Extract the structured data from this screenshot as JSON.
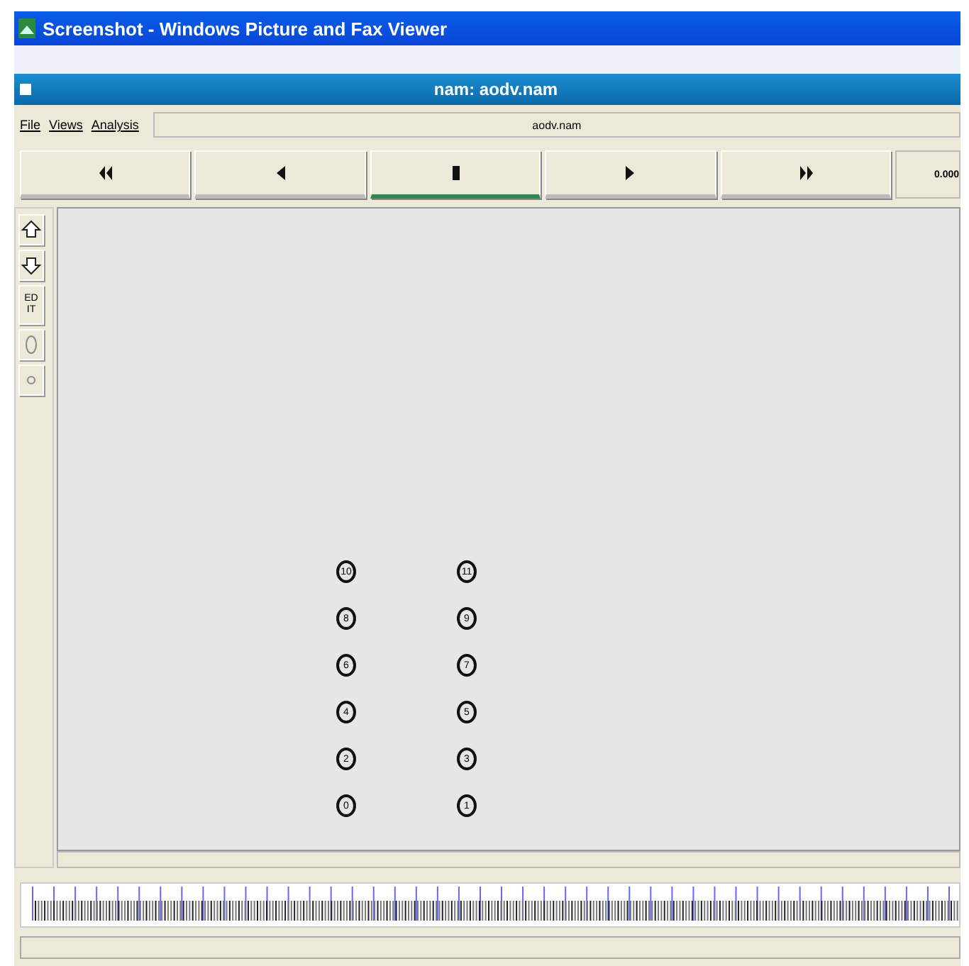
{
  "window": {
    "title": "Screenshot - Windows Picture and Fax Viewer"
  },
  "app": {
    "title": "nam: aodv.nam"
  },
  "menu": [
    {
      "label": "File"
    },
    {
      "label": "Views"
    },
    {
      "label": "Analysis"
    }
  ],
  "file_name": "aodv.nam",
  "playback_buttons": [
    {
      "kind": "rewind",
      "selected": false
    },
    {
      "kind": "back",
      "selected": false
    },
    {
      "kind": "stop",
      "selected": true
    },
    {
      "kind": "play",
      "selected": false
    },
    {
      "kind": "forward",
      "selected": false
    }
  ],
  "time": "0.000",
  "tools": [
    {
      "kind": "zoom-in"
    },
    {
      "kind": "zoom-out"
    },
    {
      "kind": "edit",
      "label": "ED IT"
    },
    {
      "kind": "circle"
    },
    {
      "kind": "small-circle"
    }
  ],
  "nodes": [
    {
      "label": "10"
    },
    {
      "label": "11"
    },
    {
      "label": "8"
    },
    {
      "label": "9"
    },
    {
      "label": "6"
    },
    {
      "label": "7"
    },
    {
      "label": "4"
    },
    {
      "label": "5"
    },
    {
      "label": "2"
    },
    {
      "label": "3"
    },
    {
      "label": "0"
    },
    {
      "label": "1"
    }
  ]
}
